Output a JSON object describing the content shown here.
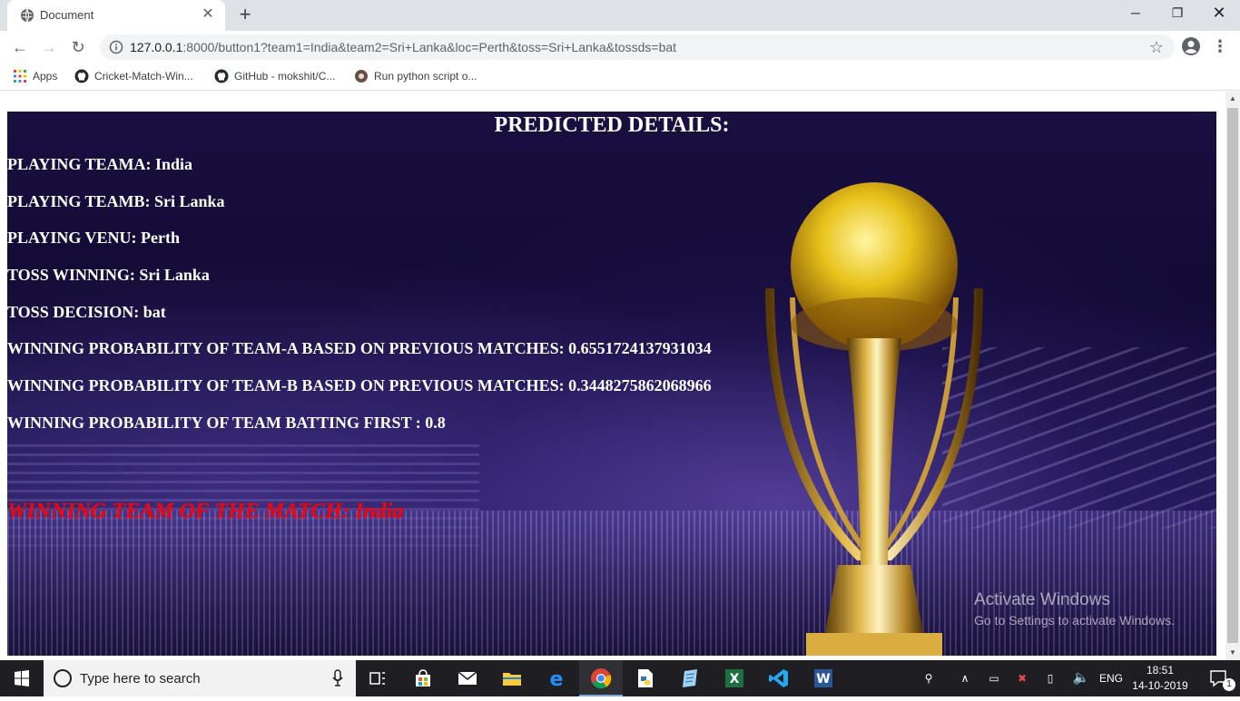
{
  "browser": {
    "tab_title": "Document",
    "url_host": "127.0.0.1",
    "url_rest": ":8000/button1?team1=India&team2=Sri+Lanka&loc=Perth&toss=Sri+Lanka&tossds=bat",
    "bookmarks": [
      {
        "label": "Apps",
        "icon": "apps-grid-icon"
      },
      {
        "label": "Cricket-Match-Win...",
        "icon": "github-icon"
      },
      {
        "label": "GitHub - mokshit/C...",
        "icon": "github-icon"
      },
      {
        "label": "Run python script o...",
        "icon": "site-favicon-icon"
      }
    ]
  },
  "page": {
    "heading": "PREDICTED DETAILS:",
    "rows": [
      "PLAYING TEAMA: India",
      "PLAYING TEAMB: Sri Lanka",
      "PLAYING VENU: Perth",
      "TOSS WINNING: Sri Lanka",
      "TOSS DECISION: bat",
      "WINNING PROBABILITY OF TEAM-A BASED ON PREVIOUS MATCHES: 0.6551724137931034",
      "WINNING PROBABILITY OF TEAM-B BASED ON PREVIOUS MATCHES: 0.3448275862068966",
      "WINNING PROBABILITY OF TEAM BATTING FIRST : 0.8"
    ],
    "winner": "WINNING TEAM OF THE MATCH: India",
    "accent_color": "#ff0000"
  },
  "watermark": {
    "line1": "Activate Windows",
    "line2": "Go to Settings to activate Windows."
  },
  "taskbar": {
    "search_placeholder": "Type here to search",
    "language": "ENG",
    "time": "18:51",
    "date": "14-10-2019",
    "notification_count": "1"
  }
}
